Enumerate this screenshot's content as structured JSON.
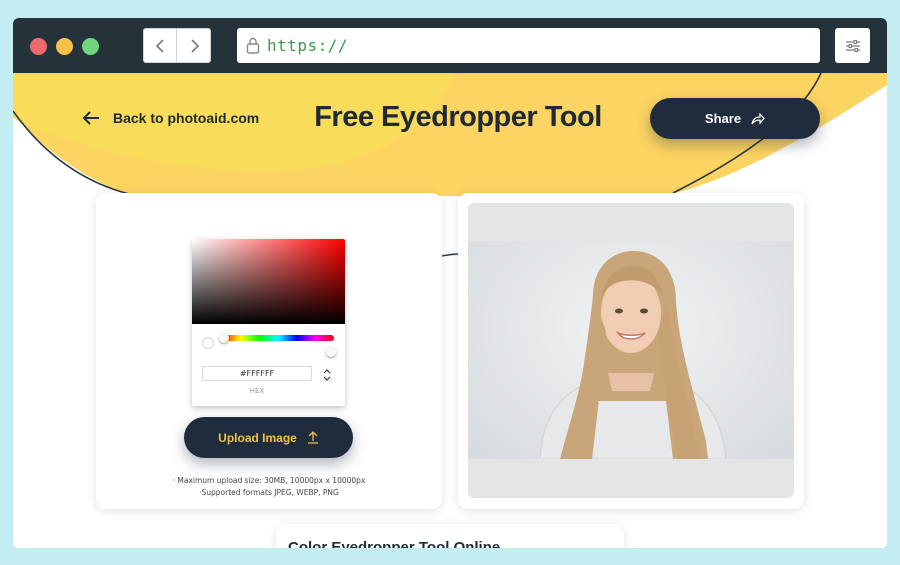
{
  "browser": {
    "url": "https://"
  },
  "header": {
    "back_label": "Back to photoaid.com",
    "title": "Free Eyedropper Tool",
    "share_label": "Share"
  },
  "picker": {
    "hex_value": "#FFFFFF",
    "hex_label": "HEX"
  },
  "upload": {
    "button_label": "Upload Image",
    "note_size": "· Maximum upload size: 30MB, 10000px x 10000px",
    "note_formats": "·Supported formats JPEG, WEBP, PNG"
  },
  "section": {
    "heading_partial": "Color Eyedropper Tool Online"
  },
  "colors": {
    "accent_dark": "#1f2c3d",
    "accent_yellow": "#f5c14a",
    "titlebar": "#253239",
    "background": "#c3ecf3"
  },
  "icons": {
    "back": "arrow-left-icon",
    "share": "share-arrow-icon",
    "upload": "upload-arrow-icon",
    "lock": "lock-icon",
    "settings": "sliders-icon"
  }
}
